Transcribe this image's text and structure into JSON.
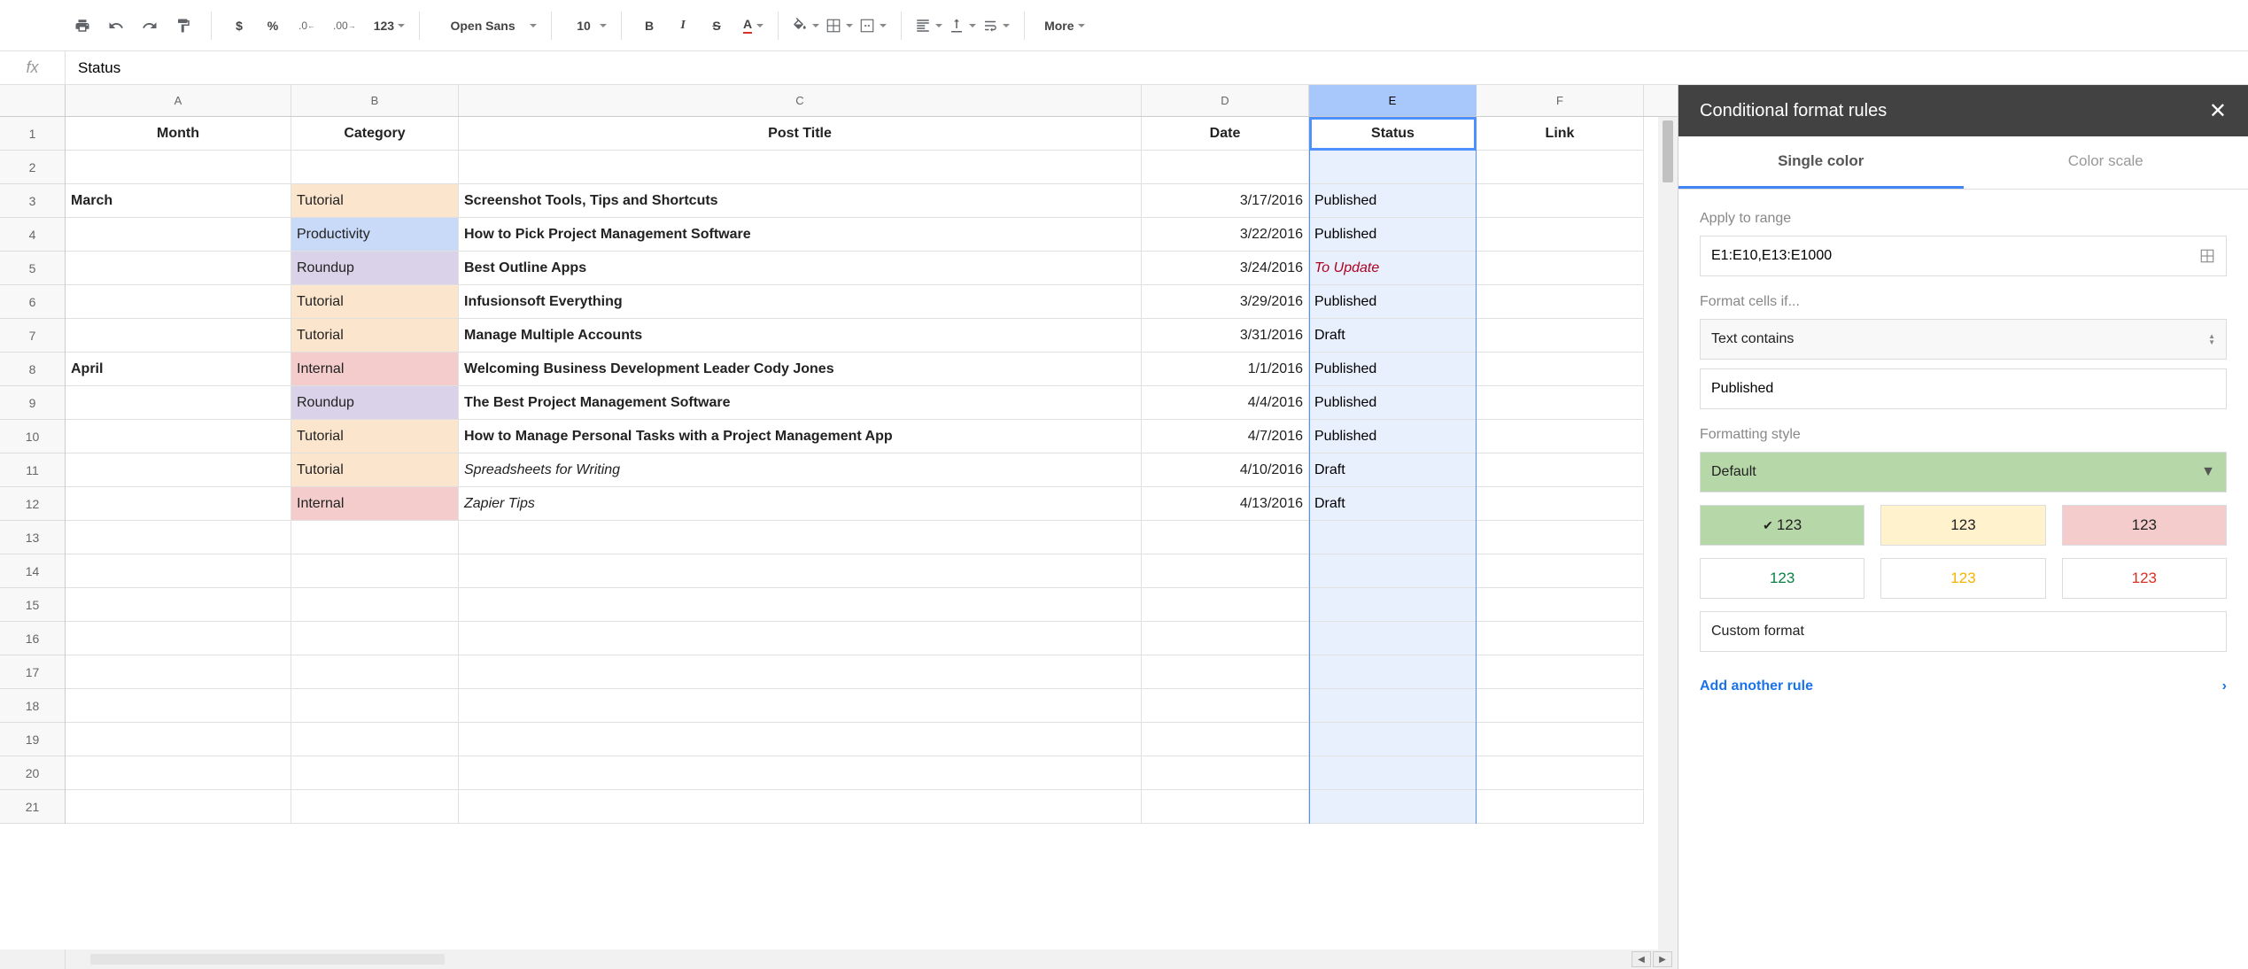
{
  "toolbar": {
    "dollar": "$",
    "percent": "%",
    "dec_dec": ".0",
    "inc_dec": ".00",
    "num_fmt": "123",
    "font": "Open Sans",
    "font_size": "10",
    "bold": "B",
    "italic": "I",
    "strike": "S",
    "text_color": "A",
    "more": "More"
  },
  "formula_bar": {
    "fx": "fx",
    "value": "Status"
  },
  "columns": [
    "A",
    "B",
    "C",
    "D",
    "E",
    "F"
  ],
  "headers": {
    "A": "Month",
    "B": "Category",
    "C": "Post Title",
    "D": "Date",
    "E": "Status",
    "F": "Link"
  },
  "rows": [
    {
      "n": 2
    },
    {
      "n": 3,
      "A": "March",
      "B": "Tutorial",
      "C": "Screenshot Tools, Tips and Shortcuts",
      "D": "3/17/2016",
      "E": "Published"
    },
    {
      "n": 4,
      "B": "Productivity",
      "C": "How to Pick Project Management Software",
      "D": "3/22/2016",
      "E": "Published"
    },
    {
      "n": 5,
      "B": "Roundup",
      "C": "Best Outline Apps",
      "D": "3/24/2016",
      "E": "To Update"
    },
    {
      "n": 6,
      "B": "Tutorial",
      "C": "Infusionsoft Everything",
      "D": "3/29/2016",
      "E": "Published"
    },
    {
      "n": 7,
      "B": "Tutorial",
      "C": "Manage Multiple Accounts",
      "D": "3/31/2016",
      "E": "Draft"
    },
    {
      "n": 8,
      "A": "April",
      "B": "Internal",
      "C": "Welcoming Business Development Leader Cody Jones",
      "D": "1/1/2016",
      "E": "Published"
    },
    {
      "n": 9,
      "B": "Roundup",
      "C": "The Best Project Management Software",
      "D": "4/4/2016",
      "E": "Published"
    },
    {
      "n": 10,
      "B": "Tutorial",
      "C": "How to Manage Personal Tasks with a Project Management App",
      "D": "4/7/2016",
      "E": "Published"
    },
    {
      "n": 11,
      "B": "Tutorial",
      "C": "Spreadsheets for Writing",
      "D": "4/10/2016",
      "E": "Draft",
      "italic": true
    },
    {
      "n": 12,
      "B": "Internal",
      "C": "Zapier Tips",
      "D": "4/13/2016",
      "E": "Draft",
      "italic": true
    },
    {
      "n": 13
    },
    {
      "n": 14
    },
    {
      "n": 15
    },
    {
      "n": 16
    },
    {
      "n": 17
    },
    {
      "n": 18
    },
    {
      "n": 19
    },
    {
      "n": 20
    },
    {
      "n": 21
    }
  ],
  "side_panel": {
    "title": "Conditional format rules",
    "tab_single": "Single color",
    "tab_scale": "Color scale",
    "apply_label": "Apply to range",
    "apply_value": "E1:E10,E13:E1000",
    "condition_label": "Format cells if...",
    "condition_value": "Text contains",
    "condition_text": "Published",
    "style_label": "Formatting style",
    "style_value": "Default",
    "preset_label": "123",
    "custom_format": "Custom format",
    "add_rule": "Add another rule"
  }
}
